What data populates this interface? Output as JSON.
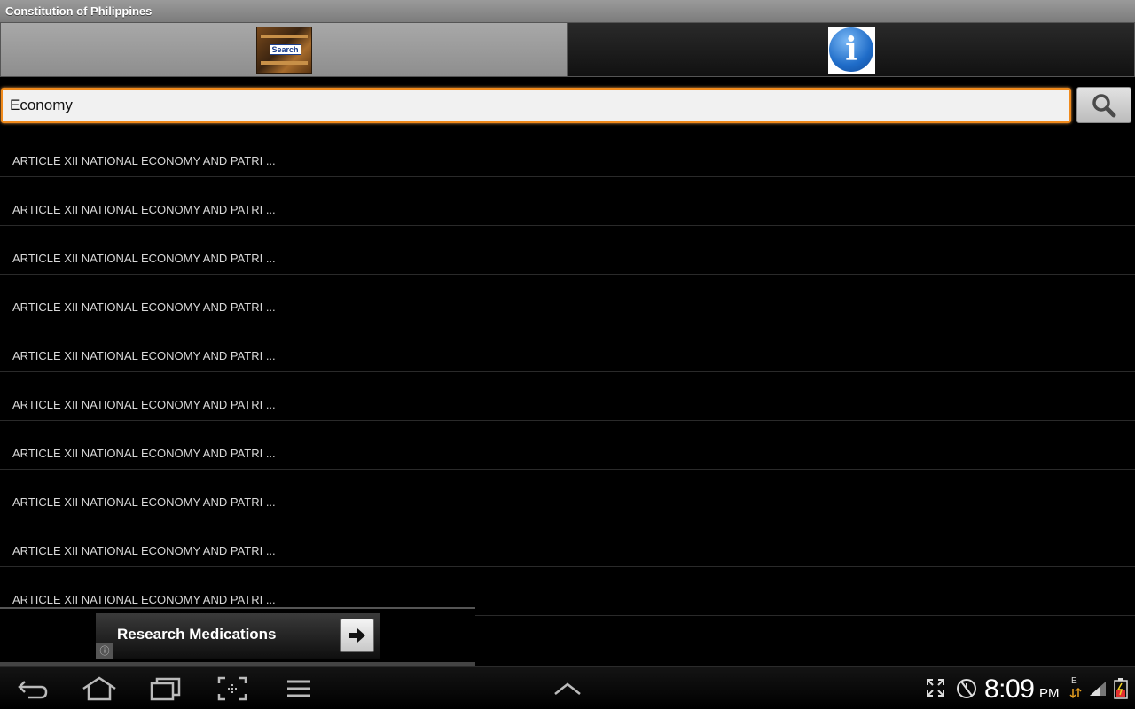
{
  "app": {
    "title": "Constitution of Philippines"
  },
  "tabs": [
    {
      "label": "Search",
      "icon": "library-search-icon"
    },
    {
      "label": "",
      "icon": "info-icon"
    }
  ],
  "search": {
    "value": "Economy",
    "placeholder": "",
    "button_icon": "magnifier-icon"
  },
  "results": [
    "ARTICLE  XII NATIONAL ECONOMY AND PATRI ...",
    "ARTICLE  XII NATIONAL ECONOMY AND PATRI ...",
    "ARTICLE  XII NATIONAL ECONOMY AND PATRI ...",
    "ARTICLE  XII NATIONAL ECONOMY AND PATRI ...",
    "ARTICLE  XII NATIONAL ECONOMY AND PATRI ...",
    "ARTICLE  XII NATIONAL ECONOMY AND PATRI ...",
    "ARTICLE  XII NATIONAL ECONOMY AND PATRI ...",
    "ARTICLE  XII NATIONAL ECONOMY AND PATRI ...",
    "ARTICLE  XII NATIONAL ECONOMY AND PATRI ...",
    "ARTICLE  XII NATIONAL ECONOMY AND PATRI ..."
  ],
  "ad": {
    "text": "Research Medications",
    "info_glyph": "ⓘ"
  },
  "status": {
    "time": "8:09",
    "ampm": "PM",
    "network": "E"
  },
  "colors": {
    "accent": "#f08a1c",
    "background": "#000000"
  }
}
